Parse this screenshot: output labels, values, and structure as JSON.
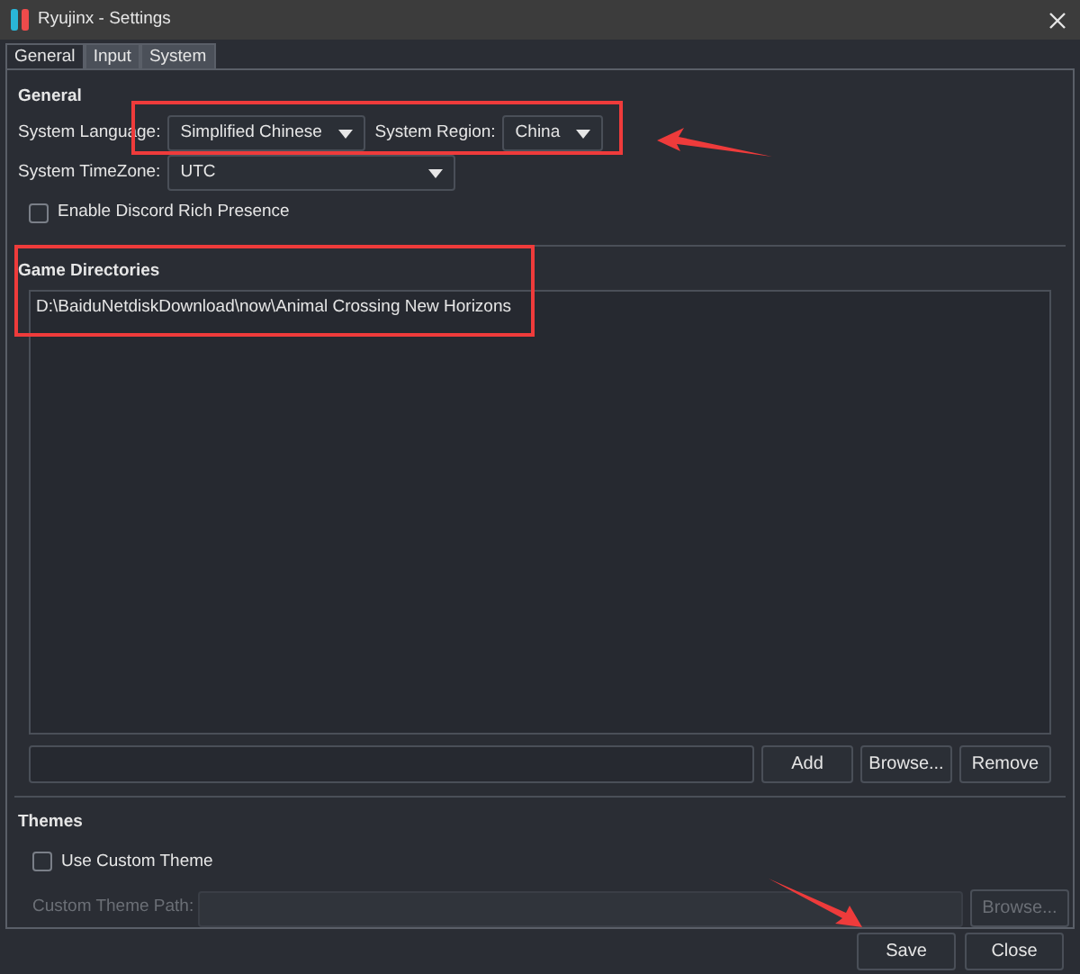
{
  "window": {
    "title": "Ryujinx - Settings"
  },
  "tabs": [
    {
      "label": "General",
      "selected": true
    },
    {
      "label": "Input",
      "selected": false
    },
    {
      "label": "System",
      "selected": false
    }
  ],
  "general": {
    "heading": "General",
    "system_language": {
      "label": "System Language:",
      "value": "Simplified Chinese"
    },
    "system_region": {
      "label": "System Region:",
      "value": "China"
    },
    "system_timezone": {
      "label": "System TimeZone:",
      "value": "UTC"
    },
    "discord": {
      "label": "Enable Discord Rich Presence",
      "checked": false
    }
  },
  "game_directories": {
    "heading": "Game Directories",
    "items": [
      "D:\\BaiduNetdiskDownload\\now\\Animal Crossing New Horizons"
    ],
    "buttons": [
      "Add",
      "Browse...",
      "Remove"
    ]
  },
  "themes": {
    "heading": "Themes",
    "custom_theme": {
      "label": "Use Custom Theme",
      "checked": false
    },
    "path_label": "Custom Theme Path:",
    "disabled": true,
    "browse": "Browse..."
  },
  "footer_buttons": [
    "Save",
    "Close"
  ]
}
